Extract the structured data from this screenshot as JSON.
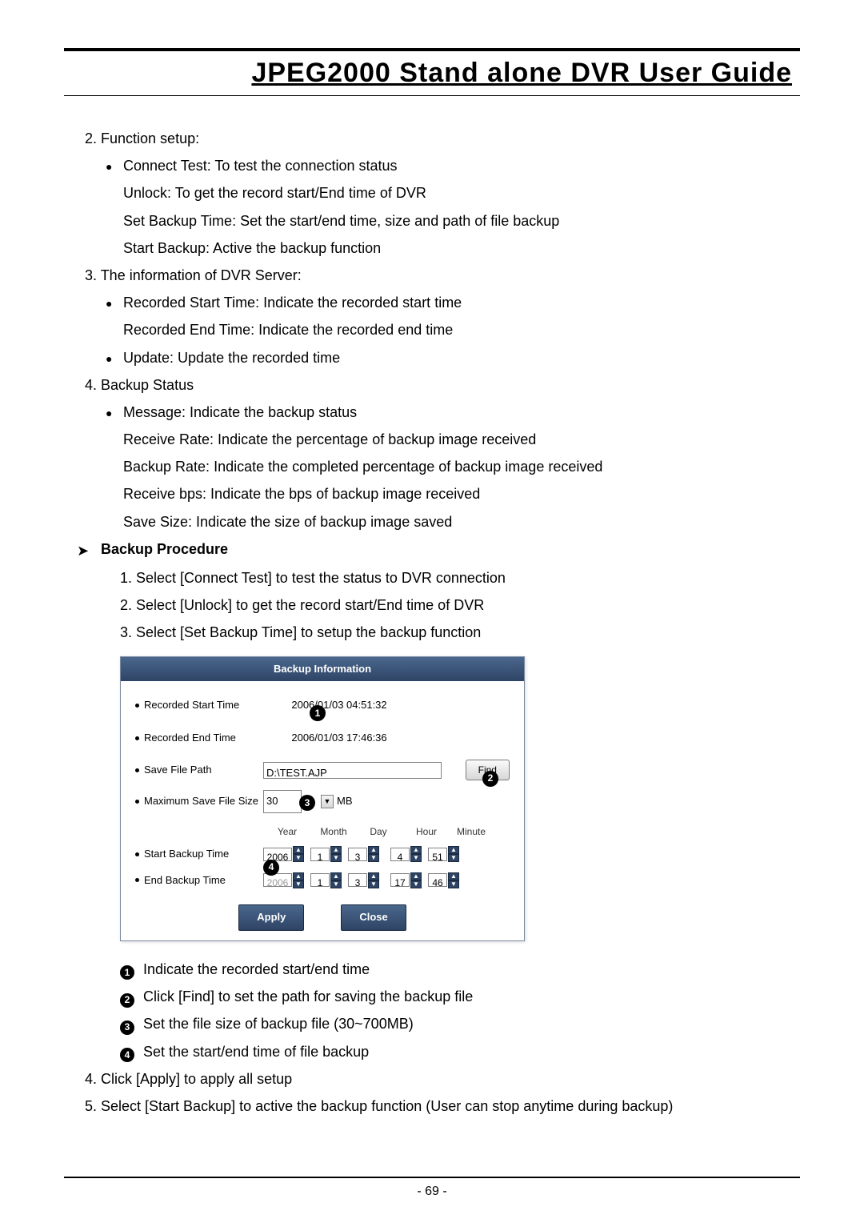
{
  "header": {
    "title": "JPEG2000  Stand  alone  DVR  User  Guide"
  },
  "text": {
    "p2": "2. Function setup:",
    "b_connect": "Connect Test: To test the connection status",
    "b_unlock": "Unlock: To get the record start/End time of DVR",
    "b_setbackup": "Set Backup Time: Set the start/end time, size and path of file backup",
    "b_startbackup": "Start Backup: Active the backup function",
    "p3": "3. The information of DVR Server:",
    "b_rstart": "Recorded Start Time: Indicate the recorded start time",
    "b_rend": "Recorded End Time: Indicate the recorded end time",
    "b_update": "Update: Update the recorded time",
    "p4": "4. Backup Status",
    "b_msg": "Message: Indicate the backup status",
    "b_rrate": "Receive Rate: Indicate the percentage of backup image received",
    "b_brate": "Backup Rate: Indicate the completed percentage of backup image received",
    "b_rbps": "Receive bps: Indicate the bps of backup image received",
    "b_ssize": "Save Size: Indicate the size of backup image saved",
    "bp_heading": "Backup Procedure",
    "bp1": "1. Select [Connect Test] to test the status to DVR connection",
    "bp2": "2. Select [Unlock] to get the record start/End time of DVR",
    "bp3": "3. Select [Set Backup Time] to setup the backup function",
    "leg1": "Indicate the recorded start/end time",
    "leg2": "Click [Find] to set the path for saving the backup file",
    "leg3": "Set the file size of backup file (30~700MB)",
    "leg4": "Set the start/end time of file backup",
    "p5": "4. Click [Apply] to apply all setup",
    "p6": "5. Select [Start Backup] to active the backup function (User can stop anytime during backup)",
    "page_num": "- 69 -"
  },
  "dialog": {
    "title": "Backup Information",
    "labels": {
      "rec_start": "Recorded Start Time",
      "rec_end": "Recorded End Time",
      "save_path": "Save File Path",
      "max_size": "Maximum Save File Size",
      "start_bk": "Start Backup Time",
      "end_bk": "End Backup Time"
    },
    "values": {
      "rec_start": "2006/01/03 04:51:32",
      "rec_end": "2006/01/03 17:46:36",
      "path": "D:\\TEST.AJP",
      "max_size": "30",
      "unit": "MB"
    },
    "headers": {
      "year": "Year",
      "month": "Month",
      "day": "Day",
      "hour": "Hour",
      "minute": "Minute"
    },
    "start_time": {
      "year": "2006",
      "month": "1",
      "day": "3",
      "hour": "4",
      "minute": "51"
    },
    "end_time": {
      "year": "2006",
      "month": "1",
      "day": "3",
      "hour": "17",
      "minute": "46"
    },
    "buttons": {
      "find": "Find",
      "apply": "Apply",
      "close": "Close"
    },
    "callouts": {
      "c1": "1",
      "c2": "2",
      "c3": "3",
      "c4": "4"
    }
  }
}
